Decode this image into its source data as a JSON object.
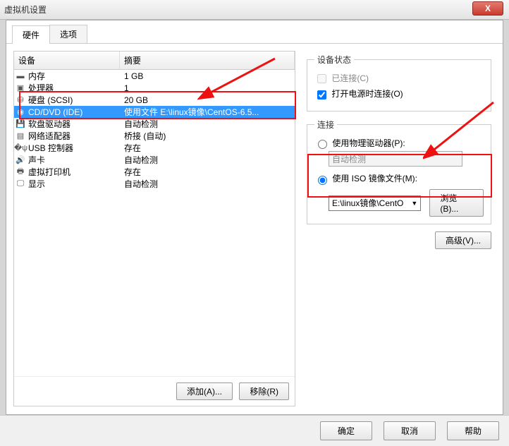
{
  "window": {
    "title": "虚拟机设置",
    "close": "X"
  },
  "tabs": {
    "hardware": "硬件",
    "options": "选项"
  },
  "headers": {
    "device": "设备",
    "summary": "摘要"
  },
  "rows": [
    {
      "icon": "▬",
      "dev": "内存",
      "sum": "1 GB"
    },
    {
      "icon": "▣",
      "dev": "处理器",
      "sum": "1"
    },
    {
      "icon": "⛁",
      "dev": "硬盘 (SCSI)",
      "sum": "20 GB"
    },
    {
      "icon": "◉",
      "dev": "CD/DVD (IDE)",
      "sum": "使用文件 E:\\linux镜像\\CentOS-6.5..."
    },
    {
      "icon": "💾",
      "dev": "软盘驱动器",
      "sum": "自动检测"
    },
    {
      "icon": "▤",
      "dev": "网络适配器",
      "sum": "桥接 (自动)"
    },
    {
      "icon": "�ψ",
      "dev": "USB 控制器",
      "sum": "存在"
    },
    {
      "icon": "🔊",
      "dev": "声卡",
      "sum": "自动检测"
    },
    {
      "icon": "🖶",
      "dev": "虚拟打印机",
      "sum": "存在"
    },
    {
      "icon": "🖵",
      "dev": "显示",
      "sum": "自动检测"
    }
  ],
  "list_buttons": {
    "add": "添加(A)...",
    "remove": "移除(R)"
  },
  "status_group": {
    "legend": "设备状态",
    "connected": "已连接(C)",
    "connect_on_power": "打开电源时连接(O)"
  },
  "conn_group": {
    "legend": "连接",
    "use_physical": "使用物理驱动器(P):",
    "auto_detect": "自动检测",
    "use_iso": "使用 ISO 镜像文件(M):",
    "iso_path": "E:\\linux镜像\\CentO",
    "browse": "浏览(B)..."
  },
  "advanced": "高级(V)...",
  "footer": {
    "ok": "确定",
    "cancel": "取消",
    "help": "帮助"
  }
}
